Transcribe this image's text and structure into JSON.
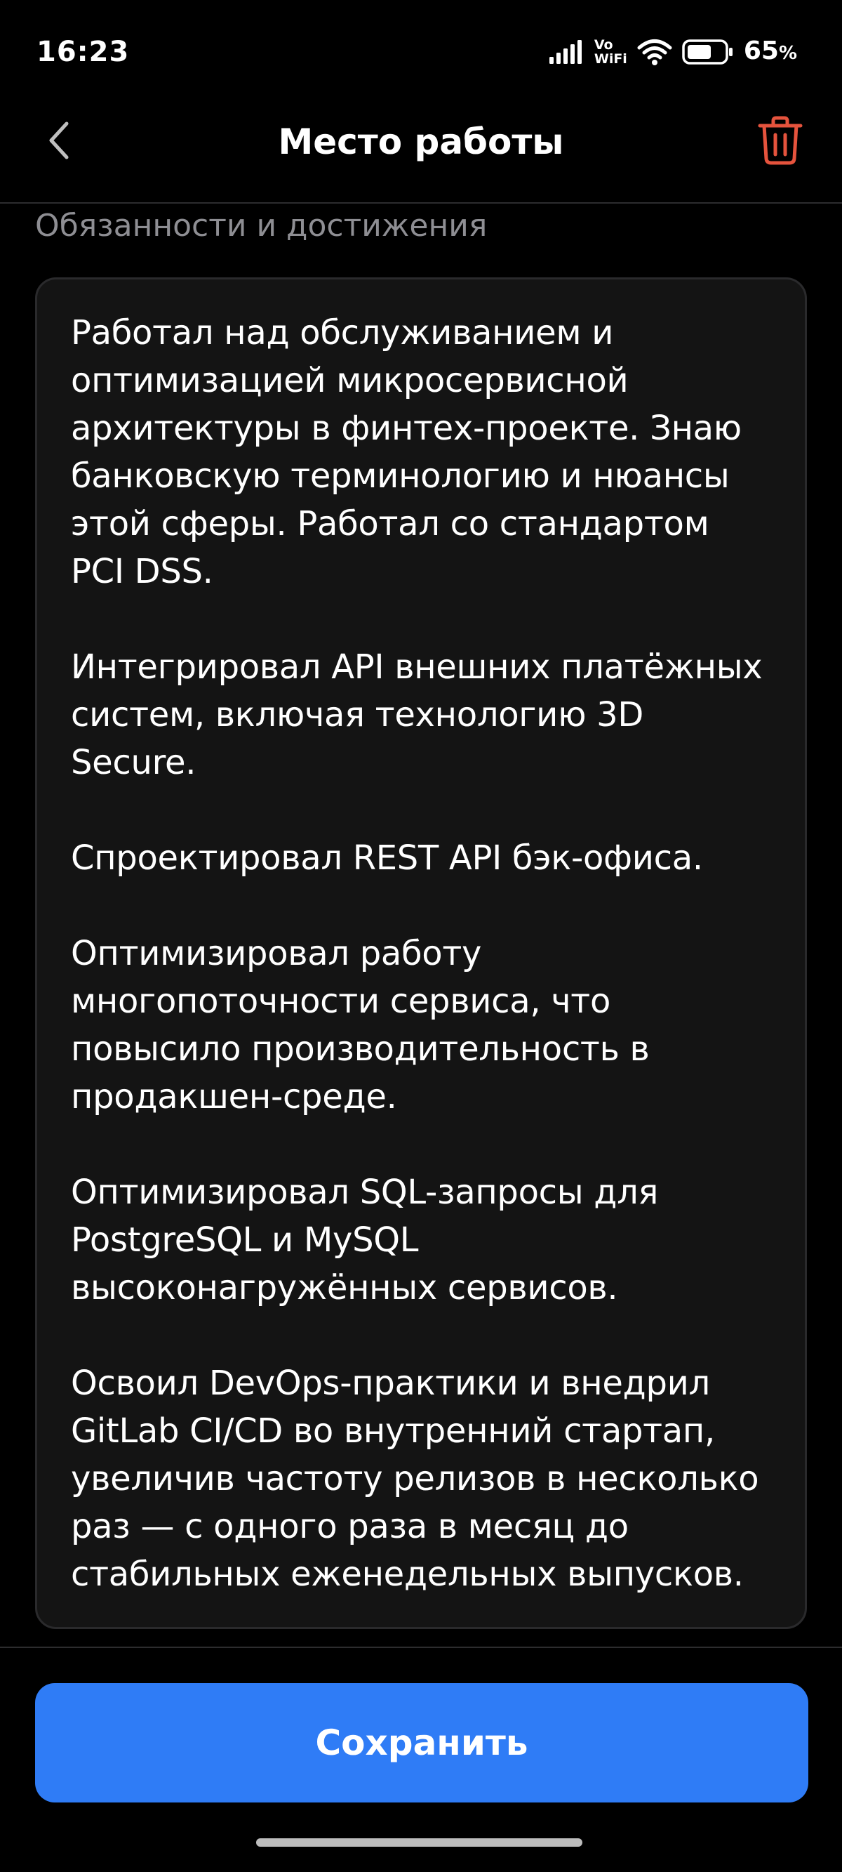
{
  "status_bar": {
    "time": "16:23",
    "vo": "Vo",
    "wifi_label": "WiFi",
    "battery_value": "65",
    "battery_unit": "%",
    "battery_level": 0.65
  },
  "header": {
    "title": "Место работы"
  },
  "section": {
    "label": "Обязанности и достижения",
    "paragraphs": [
      "Работал над обслуживанием и оптимизацией микросервисной архитектуры в финтех-проекте. Знаю банковскую терминологию и нюансы этой сферы. Работал со стандартом PCI DSS.",
      "Интегрировал API внешних платёжных систем, включая технологию 3D Secure.",
      "Спроектировал REST API бэк-офиса.",
      "Оптимизировал работу многопоточности сервиса, что повысило производительность в продакшен-среде.",
      "Оптимизировал SQL-запросы для PostgreSQL и MySQL высоконагружённых сервисов.",
      "Освоил DevOps-практики и внедрил GitLab CI/CD во внутренний стартап, увеличив частоту релизов в несколько раз — с одного раза в месяц до стабильных еженедельных выпусков."
    ]
  },
  "actions": {
    "save_label": "Сохранить"
  },
  "colors": {
    "accent": "#2f7cf6",
    "danger": "#e5533d",
    "background": "#000000",
    "field_background": "#141414",
    "muted_text": "#8e8e93"
  },
  "icons": {
    "back": "chevron-left-icon",
    "delete": "trash-icon",
    "signal": "signal-icon",
    "wifi": "wifi-icon",
    "battery": "battery-icon"
  }
}
